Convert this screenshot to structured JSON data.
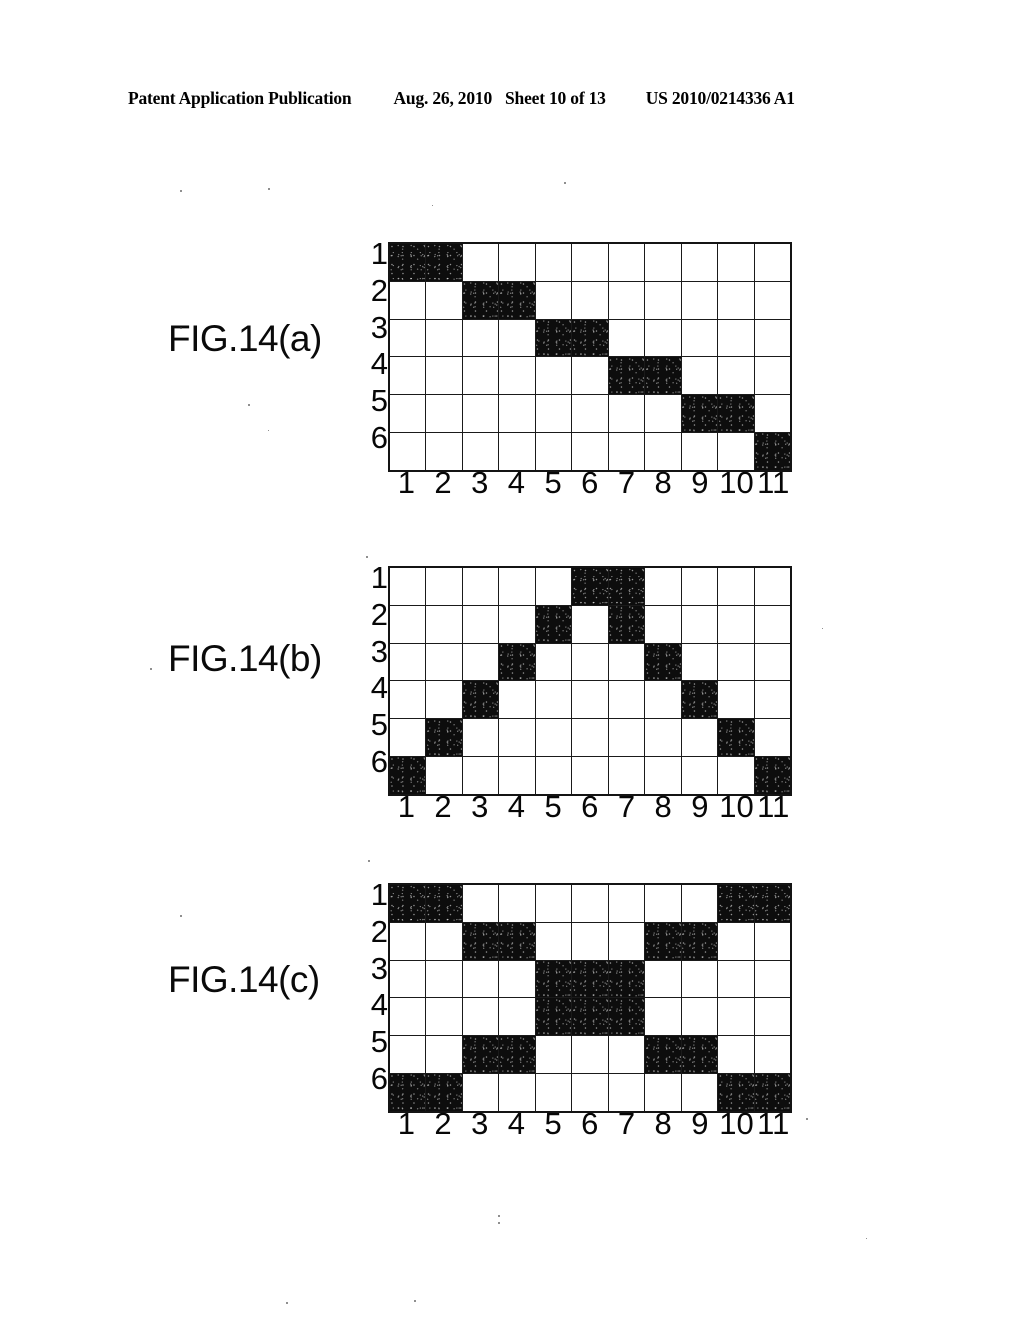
{
  "header": {
    "publication": "Patent Application Publication",
    "date": "Aug. 26, 2010",
    "sheet": "Sheet 10 of 13",
    "patent_number": "US 2010/0214336 A1"
  },
  "axis": {
    "row_labels": [
      "1",
      "2",
      "3",
      "4",
      "5",
      "6"
    ],
    "col_labels": [
      "1",
      "2",
      "3",
      "4",
      "5",
      "6",
      "7",
      "8",
      "9",
      "10",
      "11"
    ]
  },
  "colors": {
    "filled_cell": "#0d0d0d",
    "empty_cell": "#ffffff",
    "grid_line": "#1a1a1a",
    "page_background": "#ffffff",
    "text": "#000000"
  },
  "figures": [
    {
      "id": "a",
      "label": "FIG.14(a)",
      "rows": 6,
      "cols": 11,
      "description": "diagonal staircase pattern",
      "filled": [
        [
          1,
          1,
          0,
          0,
          0,
          0,
          0,
          0,
          0,
          0,
          0
        ],
        [
          0,
          0,
          1,
          1,
          0,
          0,
          0,
          0,
          0,
          0,
          0
        ],
        [
          0,
          0,
          0,
          0,
          1,
          1,
          0,
          0,
          0,
          0,
          0
        ],
        [
          0,
          0,
          0,
          0,
          0,
          0,
          1,
          1,
          0,
          0,
          0
        ],
        [
          0,
          0,
          0,
          0,
          0,
          0,
          0,
          0,
          1,
          1,
          0
        ],
        [
          0,
          0,
          0,
          0,
          0,
          0,
          0,
          0,
          0,
          0,
          1
        ]
      ]
    },
    {
      "id": "b",
      "label": "FIG.14(b)",
      "rows": 6,
      "cols": 11,
      "description": "V chevron pattern",
      "filled": [
        [
          0,
          0,
          0,
          0,
          0,
          1,
          1,
          0,
          0,
          0,
          0
        ],
        [
          0,
          0,
          0,
          0,
          1,
          0,
          1,
          0,
          0,
          0,
          0
        ],
        [
          0,
          0,
          0,
          1,
          0,
          0,
          0,
          1,
          0,
          0,
          0
        ],
        [
          0,
          0,
          1,
          0,
          0,
          0,
          0,
          0,
          1,
          0,
          0
        ],
        [
          0,
          1,
          0,
          0,
          0,
          0,
          0,
          0,
          0,
          1,
          0
        ],
        [
          1,
          0,
          0,
          0,
          0,
          0,
          0,
          0,
          0,
          0,
          1
        ]
      ]
    },
    {
      "id": "c",
      "label": "FIG.14(c)",
      "rows": 6,
      "cols": 11,
      "description": "concentric diamond pattern",
      "filled": [
        [
          1,
          1,
          0,
          0,
          0,
          0,
          0,
          0,
          0,
          1,
          1
        ],
        [
          0,
          0,
          1,
          1,
          0,
          0,
          0,
          1,
          1,
          0,
          0
        ],
        [
          0,
          0,
          0,
          0,
          1,
          1,
          1,
          0,
          0,
          0,
          0
        ],
        [
          0,
          0,
          0,
          0,
          1,
          1,
          1,
          0,
          0,
          0,
          0
        ],
        [
          0,
          0,
          1,
          1,
          0,
          0,
          0,
          1,
          1,
          0,
          0
        ],
        [
          1,
          1,
          0,
          0,
          0,
          0,
          0,
          0,
          0,
          1,
          1
        ]
      ]
    }
  ]
}
